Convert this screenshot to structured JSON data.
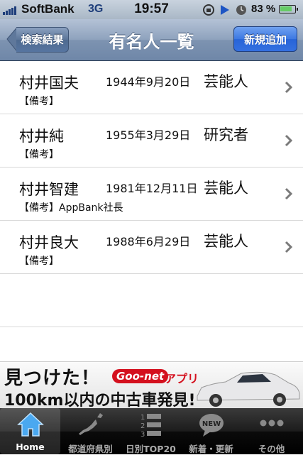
{
  "status_bar": {
    "carrier": "SoftBank",
    "network": "3G",
    "time": "19:57",
    "battery_percent": "83 %",
    "battery_level": 0.83
  },
  "nav": {
    "back_label": "検索結果",
    "title": "有名人一覧",
    "new_label": "新規追加"
  },
  "rows": [
    {
      "name": "村井国夫",
      "date": "1944年9月20日",
      "job": "芸能人",
      "note": "【備考】"
    },
    {
      "name": "村井純",
      "date": "1955年3月29日",
      "job": "研究者",
      "note": "【備考】"
    },
    {
      "name": "村井智建",
      "date": "1981年12月11日",
      "job": "芸能人",
      "note": "【備考】AppBank社長"
    },
    {
      "name": "村井良大",
      "date": "1988年6月29日",
      "job": "芸能人",
      "note": "【備考】"
    }
  ],
  "ad": {
    "line1": "見つけた！",
    "brand": "Goo-net",
    "app": "アプリ",
    "line2": "100km以内の中古車発見!"
  },
  "tabs": [
    {
      "label": "Home",
      "icon": "house-icon"
    },
    {
      "label": "都道府県別",
      "icon": "japan-map-icon"
    },
    {
      "label": "日別TOP20",
      "icon": "ranking-icon"
    },
    {
      "label": "新着・更新",
      "icon": "new-speech-icon"
    },
    {
      "label": "その他",
      "icon": "more-dots-icon"
    }
  ],
  "colors": {
    "nav_bar": "#7d93b1",
    "new_button": "#2764d8",
    "ad_red": "#d4101e"
  }
}
